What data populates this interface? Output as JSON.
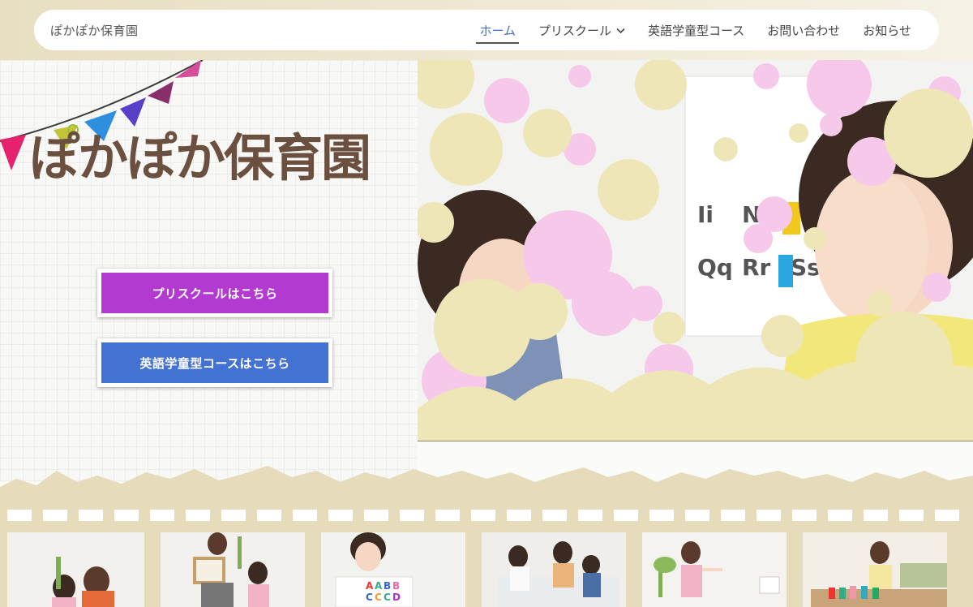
{
  "nav": {
    "site_name": "ぽかぽか保育園",
    "items": [
      {
        "label": "ホーム",
        "active": true
      },
      {
        "label": "プリスクール",
        "has_dropdown": true
      },
      {
        "label": "英語学童型コース"
      },
      {
        "label": "お問い合わせ"
      },
      {
        "label": "お知らせ"
      }
    ]
  },
  "hero": {
    "logo_text": "ぽかぽか保育園",
    "cta_preschool": "プリスクールはこちら",
    "cta_english": "英語学童型コースはこちら"
  },
  "colors": {
    "active_nav": "#3f6fc0",
    "logo_brown": "#6b4f3f",
    "cta_preschool": "#b33ad0",
    "cta_english": "#4472d2",
    "band": "#e6dcbb",
    "splash_pink": "#f6c8ea",
    "splash_cream": "#efe6b8"
  }
}
